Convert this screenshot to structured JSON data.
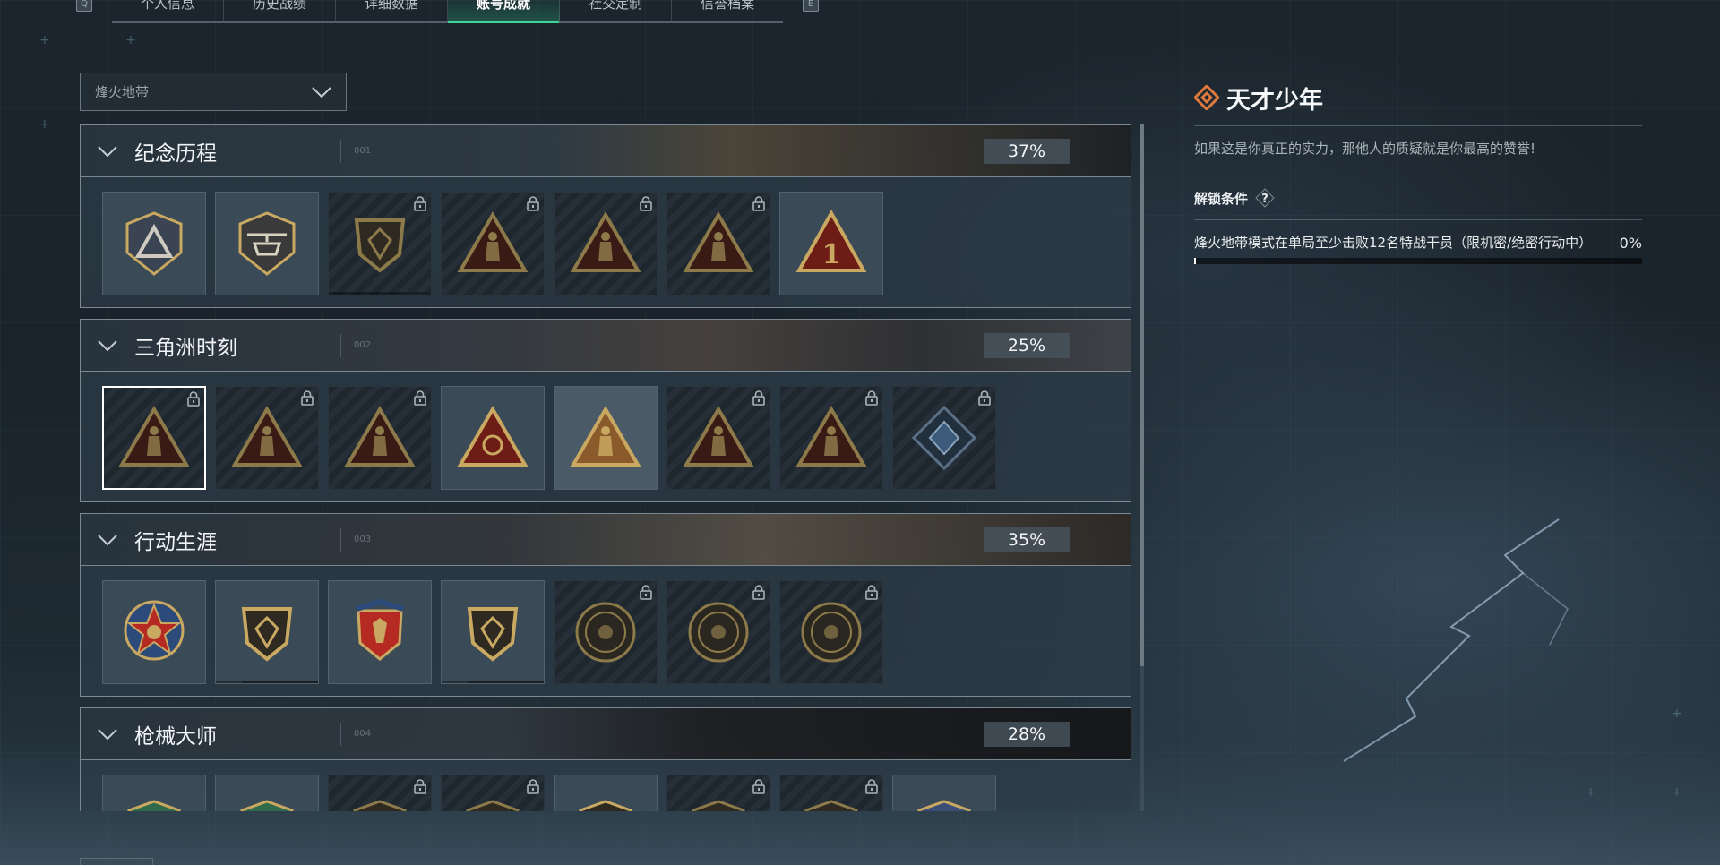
{
  "tabs": {
    "left_key": "Q",
    "right_key": "E",
    "items": [
      {
        "label": "个人信息"
      },
      {
        "label": "历史战绩"
      },
      {
        "label": "详细数据"
      },
      {
        "label": "账号成就",
        "active": true
      },
      {
        "label": "社交定制"
      },
      {
        "label": "信誉档案"
      }
    ]
  },
  "mode_select": {
    "value": "烽火地带"
  },
  "sections": [
    {
      "title": "纪念历程",
      "num": "001",
      "percent": "37%",
      "badges": [
        {
          "icon": "triangle-shield-badge",
          "locked": false
        },
        {
          "icon": "helicopter-badge",
          "locked": false
        },
        {
          "icon": "dark-shield-badge",
          "locked": true,
          "progress": 0.3
        },
        {
          "icon": "soldier-triangle-badge",
          "locked": true
        },
        {
          "icon": "figure-triangle-badge",
          "locked": true
        },
        {
          "icon": "helmet-triangle-badge",
          "locked": true
        },
        {
          "icon": "number-one-badge",
          "locked": false
        }
      ]
    },
    {
      "title": "三角洲时刻",
      "num": "002",
      "percent": "25%",
      "badges": [
        {
          "icon": "tower-triangle-badge",
          "locked": true,
          "selected": true
        },
        {
          "icon": "mask-triangle-badge",
          "locked": true
        },
        {
          "icon": "kneeling-triangle-badge",
          "locked": true
        },
        {
          "icon": "gem-triangle-badge",
          "locked": false
        },
        {
          "icon": "squad-triangle-badge",
          "locked": false,
          "light": true
        },
        {
          "icon": "team-triangle-badge",
          "locked": true
        },
        {
          "icon": "bird-triangle-badge",
          "locked": true
        },
        {
          "icon": "diamond-crest-badge",
          "locked": true
        }
      ]
    },
    {
      "title": "行动生涯",
      "num": "003",
      "percent": "35%",
      "badges": [
        {
          "icon": "star-medal-badge",
          "locked": false
        },
        {
          "icon": "bronze-shield-badge",
          "locked": false,
          "progress": 0.75
        },
        {
          "icon": "eagle-shield-badge",
          "locked": false
        },
        {
          "icon": "diamond-shield-badge",
          "locked": false,
          "progress": 0.75
        },
        {
          "icon": "circle-emblem-badge",
          "locked": true
        },
        {
          "icon": "skull-circle-badge",
          "locked": true
        },
        {
          "icon": "eye-circle-badge",
          "locked": true
        }
      ]
    },
    {
      "title": "枪械大师",
      "num": "004",
      "percent": "28%",
      "badges": [
        {
          "icon": "green-rifle-badge",
          "locked": false
        },
        {
          "icon": "green-rifle-badge",
          "locked": false
        },
        {
          "icon": "rifle-badge",
          "locked": true
        },
        {
          "icon": "rifle-badge",
          "locked": true
        },
        {
          "icon": "rifle-badge",
          "locked": false
        },
        {
          "icon": "rifle-badge",
          "locked": true
        },
        {
          "icon": "rifle-badge",
          "locked": true
        },
        {
          "icon": "gold-rifle-badge",
          "locked": false
        }
      ]
    }
  ],
  "detail": {
    "title": "天才少年",
    "description": "如果这是你真正的实力，那他人的质疑就是你最高的赞誉!",
    "condition_label": "解锁条件",
    "help_icon": "help-icon",
    "requirement": "烽火地带模式在单局至少击败12名特战干员（限机密/绝密行动中）",
    "requirement_percent": "0%",
    "progress": 0
  },
  "colors": {
    "accent": "#3fd49a",
    "gold": "#c9a862",
    "diamond_icon": "#e07a3c"
  }
}
